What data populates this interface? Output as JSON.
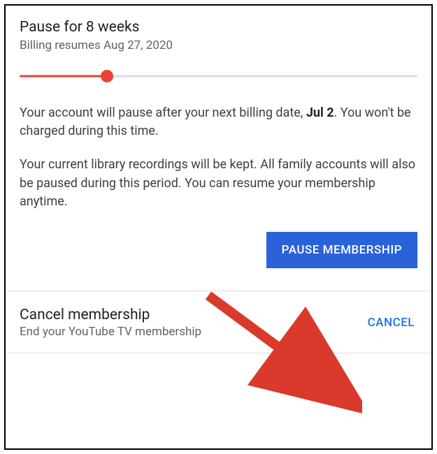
{
  "pause": {
    "title": "Pause for 8 weeks",
    "subtitle": "Billing resumes Aug 27, 2020",
    "desc1_before": "Your account will pause after your next billing date, ",
    "desc1_bold": "Jul 2",
    "desc1_after": ". You won't be charged during this time.",
    "desc2": "Your current library recordings will be kept. All family accounts will also be paused during this period. You can resume your membership anytime.",
    "button_label": "PAUSE MEMBERSHIP"
  },
  "cancel": {
    "title": "Cancel membership",
    "subtitle": "End your YouTube TV membership",
    "link_label": "CANCEL"
  }
}
